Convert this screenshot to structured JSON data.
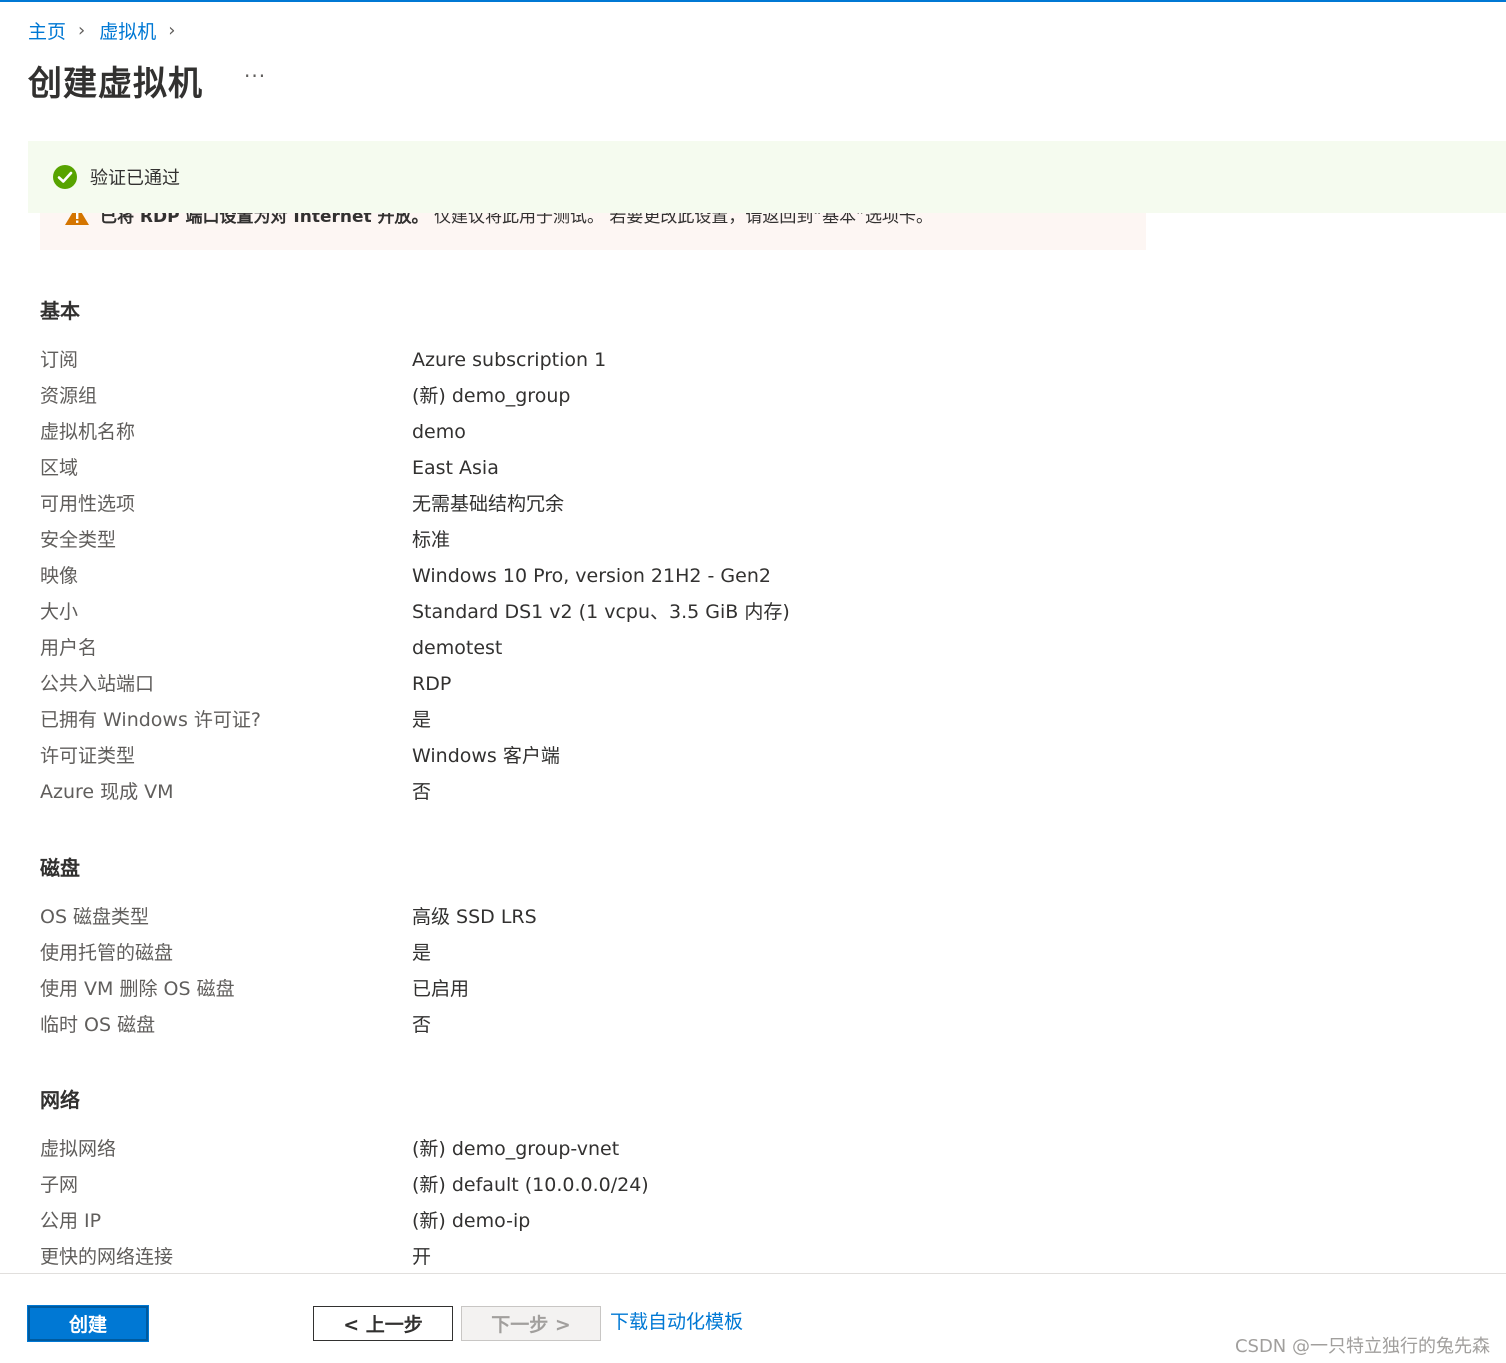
{
  "breadcrumb": {
    "home": "主页",
    "vm": "虚拟机"
  },
  "page_title": "创建虚拟机",
  "more_label": "···",
  "validation": {
    "text": "验证已通过"
  },
  "warning": {
    "text_bold": "已将 RDP 端口设置为对 Internet 开放。",
    "text_rest": " 仅建议将此用于测试。 若要更改此设置，请返回到“基本”选项卡。"
  },
  "sections": {
    "basic": {
      "title": "基本",
      "rows": [
        {
          "label": "订阅",
          "value": "Azure subscription 1"
        },
        {
          "label": "资源组",
          "value": "(新) demo_group"
        },
        {
          "label": "虚拟机名称",
          "value": "demo"
        },
        {
          "label": "区域",
          "value": "East Asia"
        },
        {
          "label": "可用性选项",
          "value": "无需基础结构冗余"
        },
        {
          "label": "安全类型",
          "value": "标准"
        },
        {
          "label": "映像",
          "value": "Windows 10 Pro, version 21H2 - Gen2"
        },
        {
          "label": "大小",
          "value": "Standard DS1 v2 (1 vcpu、3.5 GiB 内存)"
        },
        {
          "label": "用户名",
          "value": "demotest"
        },
        {
          "label": "公共入站端口",
          "value": "RDP"
        },
        {
          "label": "已拥有 Windows 许可证?",
          "value": "是"
        },
        {
          "label": "许可证类型",
          "value": "Windows 客户端"
        },
        {
          "label": "Azure 现成 VM",
          "value": "否"
        }
      ]
    },
    "disk": {
      "title": "磁盘",
      "rows": [
        {
          "label": "OS 磁盘类型",
          "value": "高级 SSD LRS"
        },
        {
          "label": "使用托管的磁盘",
          "value": "是"
        },
        {
          "label": "使用 VM 删除 OS 磁盘",
          "value": "已启用"
        },
        {
          "label": "临时 OS 磁盘",
          "value": "否"
        }
      ]
    },
    "network": {
      "title": "网络",
      "rows": [
        {
          "label": "虚拟网络",
          "value": "(新) demo_group-vnet"
        },
        {
          "label": "子网",
          "value": "(新) default (10.0.0.0/24)"
        },
        {
          "label": "公用 IP",
          "value": "(新) demo-ip"
        },
        {
          "label": "更快的网络连接",
          "value": "开"
        }
      ]
    }
  },
  "footer": {
    "create": "创建",
    "prev": "< 上一步",
    "next": "下一步 >",
    "download": "下载自动化模板",
    "watermark": "CSDN @一只特立独行的兔先森"
  },
  "colors": {
    "accent": "#0078d4",
    "success": "#57a300",
    "warning": "#d47500"
  }
}
